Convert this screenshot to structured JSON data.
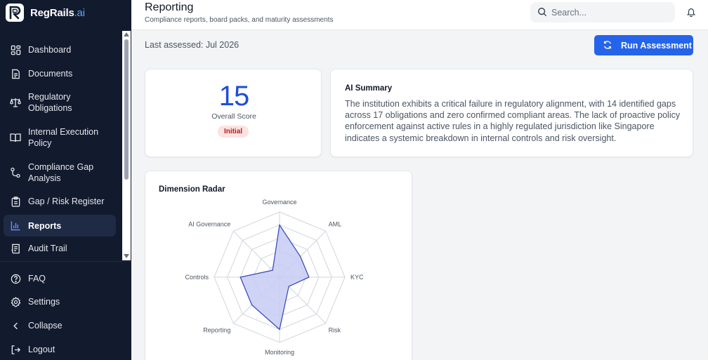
{
  "brand": {
    "name": "RegRails",
    "suffix": ".ai"
  },
  "sidebar": {
    "items": [
      {
        "label": "Dashboard",
        "icon": "dashboard-icon"
      },
      {
        "label": "Documents",
        "icon": "document-icon"
      },
      {
        "label": "Regulatory Obligations",
        "icon": "scale-icon"
      },
      {
        "label": "Internal Execution Policy",
        "icon": "book-icon"
      },
      {
        "label": "Compliance Gap Analysis",
        "icon": "branch-icon"
      },
      {
        "label": "Gap / Risk Register",
        "icon": "clipboard-icon"
      },
      {
        "label": "Reports",
        "icon": "bar-chart-icon",
        "active": true
      },
      {
        "label": "Audit Trail",
        "icon": "receipt-icon"
      }
    ],
    "bottom": [
      {
        "label": "FAQ",
        "icon": "help-circle-icon"
      },
      {
        "label": "Settings",
        "icon": "gear-icon"
      },
      {
        "label": "Collapse",
        "icon": "chevron-left-icon"
      },
      {
        "label": "Logout",
        "icon": "logout-icon"
      }
    ]
  },
  "header": {
    "title": "Reporting",
    "subtitle": "Compliance reports, board packs, and maturity assessments",
    "search_placeholder": "Search..."
  },
  "main": {
    "last_assessed": "Last assessed: Jul 2026",
    "run_button": "Run Assessment",
    "score": {
      "value": "15",
      "label": "Overall Score",
      "badge": "Initial"
    },
    "summary": {
      "title": "AI Summary",
      "text": "The institution exhibits a critical failure in regulatory alignment, with 14 identified gaps across 17 obligations and zero confirmed compliant areas. The lack of proactive policy enforcement against active rules in a highly regulated jurisdiction like Singapore indicates a systemic breakdown in internal controls and risk oversight."
    },
    "radar_title": "Dimension Radar"
  },
  "colors": {
    "accent": "#2563eb",
    "sidebar_bg": "#121a2e",
    "radar_fill": "#c7cdf5",
    "radar_stroke": "#3b4cc0"
  },
  "chart_data": {
    "type": "radar",
    "title": "Dimension Radar",
    "axes": [
      "Governance",
      "AML",
      "KYC",
      "Risk",
      "Monitoring",
      "Reporting",
      "Controls",
      "AI Governance"
    ],
    "values": [
      80,
      45,
      45,
      20,
      80,
      60,
      60,
      15
    ],
    "range": [
      0,
      100
    ],
    "rings": 5
  }
}
